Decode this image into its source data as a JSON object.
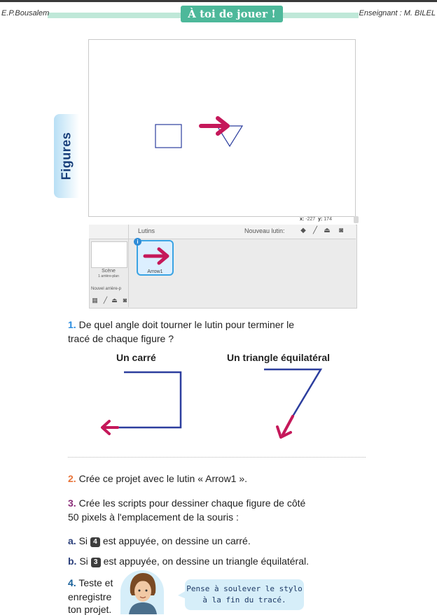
{
  "header": {
    "left_text": "E.P.Bousalem",
    "center_title": "À toi de jouer !",
    "right_text": "Enseignant : M. BILEL",
    "colors": {
      "band": "#bfe8d8",
      "pill": "#4db89a"
    }
  },
  "side_tab": {
    "label": "Figures",
    "color": "#173e7a"
  },
  "stage": {
    "coords": {
      "x_label": "x:",
      "x_value": "-227",
      "y_label": "y:",
      "y_value": "174"
    }
  },
  "sprite_pane": {
    "lutins_label": "Lutins",
    "nouveau_lutin_label": "Nouveau lutin:",
    "scene_label": "Scène",
    "scene_sublabel": "1 arrière-plan",
    "nouvel_arriere_label": "Nouvel arrière-p",
    "sprite_name": "Arrow1",
    "info_badge": "i",
    "icons": [
      "paint-icon",
      "brush-icon",
      "upload-icon",
      "camera-icon"
    ]
  },
  "questions": {
    "q1_num": "1.",
    "q1_line1": "De quel angle doit tourner le lutin pour terminer le",
    "q1_line2": "tracé de chaque figure ?",
    "shape1_title": "Un carré",
    "shape2_title": "Un triangle équilatéral",
    "q2_num": "2.",
    "q2_text": "Crée ce projet avec le lutin « Arrow1 ».",
    "q3_num": "3.",
    "q3_line1": "Crée les scripts pour dessiner chaque figure de côté",
    "q3_line2": "50 pixels à l'emplacement de la souris :",
    "a_label": "a.",
    "a_pre": "Si",
    "a_key": "4",
    "a_post": "est appuyée, on dessine un carré.",
    "b_label": "b.",
    "b_pre": "Si",
    "b_key": "3",
    "b_post": "est appuyée, on dessine un triangle équilatéral.",
    "q4_num": "4.",
    "q4_line1": "Teste et",
    "q4_line2": "enregistre",
    "q4_line3": "ton projet.",
    "bubble_line1": "Pense à soulever le stylo",
    "bubble_line2": "à la fin du tracé."
  }
}
